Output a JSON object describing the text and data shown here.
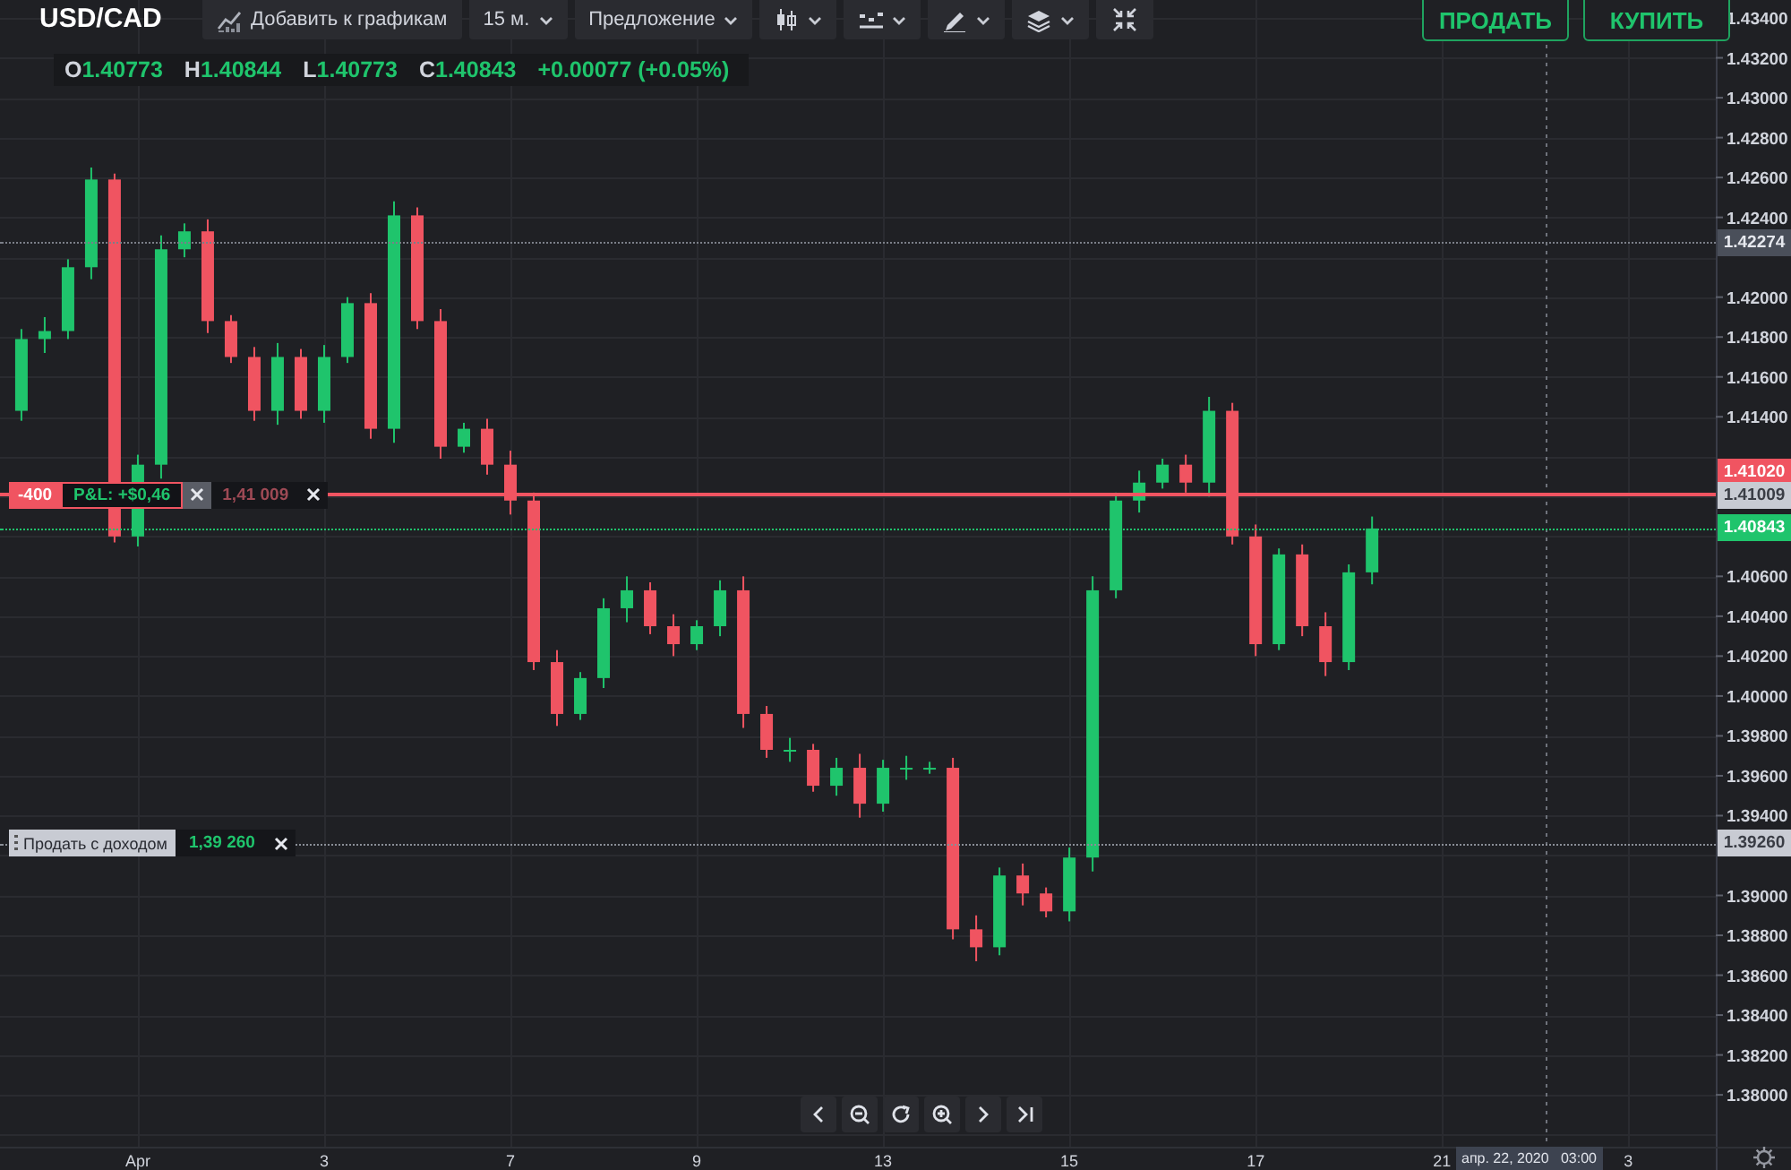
{
  "symbol": "USD/CAD",
  "toolbar": [
    {
      "kind": "add",
      "label": "Добавить к графикам"
    },
    {
      "kind": "dropdown",
      "label": "15 м."
    },
    {
      "kind": "dropdown",
      "label": "Предложение"
    },
    {
      "kind": "icon-dropdown"
    },
    {
      "kind": "icon-dropdown"
    },
    {
      "kind": "icon-dropdown"
    },
    {
      "kind": "icon-dropdown"
    },
    {
      "kind": "icon"
    }
  ],
  "ohlc": [
    {
      "key": "O",
      "value": "1.40773"
    },
    {
      "key": "H",
      "value": "1.40844"
    },
    {
      "key": "L",
      "value": "1.40773"
    },
    {
      "key": "C",
      "value": "1.40843"
    }
  ],
  "change": "+0.00077 (+0.05%)",
  "actions": [
    {
      "label": "ПРОДАТЬ"
    },
    {
      "label": "КУПИТЬ"
    }
  ],
  "orders": [
    {
      "kind": "position",
      "quantity": "-400",
      "pnl": "P&L: +$0,46",
      "price": "1,41 009"
    },
    {
      "kind": "take-profit",
      "label": "Продать с доходом",
      "price": "1,39 260"
    }
  ],
  "price_labels": [
    {
      "kind": "marker",
      "value": "1.42274",
      "color": "#4a4f5a"
    },
    {
      "kind": "ask",
      "value": "1.41020",
      "color": "#f05461"
    },
    {
      "kind": "order",
      "value": "1.41009",
      "color": "#c8cbd3"
    },
    {
      "kind": "last",
      "value": "1.40843",
      "color": "#1fc46c"
    },
    {
      "kind": "order",
      "value": "1.39260",
      "color": "#c8cbd3"
    }
  ],
  "crosshair": {
    "label": "апр. 22, 2020   03:00"
  },
  "nav": [
    {
      "kind": "prev"
    },
    {
      "kind": "zoom-out"
    },
    {
      "kind": "reset"
    },
    {
      "kind": "zoom-in"
    },
    {
      "kind": "next"
    },
    {
      "kind": "end"
    }
  ],
  "chart_data": {
    "type": "candlestick",
    "grid": true,
    "categories": [
      null,
      null,
      null,
      null,
      null,
      "Apr",
      null,
      null,
      null,
      null,
      null,
      null,
      null,
      "3",
      null,
      null,
      null,
      null,
      null,
      null,
      null,
      "7",
      null,
      null,
      null,
      null,
      null,
      null,
      null,
      "9",
      null,
      null,
      null,
      null,
      null,
      null,
      null,
      "13",
      null,
      null,
      null,
      null,
      null,
      null,
      null,
      "15",
      null,
      null,
      null,
      null,
      null,
      null,
      null,
      "17",
      null,
      null,
      null,
      null,
      null,
      null,
      null,
      "21",
      null,
      null,
      null,
      null,
      null,
      null,
      null,
      "3"
    ],
    "ohlc": [
      [
        1.4143,
        1.4184,
        1.4138,
        1.4179
      ],
      [
        1.4179,
        1.419,
        1.4172,
        1.4183
      ],
      [
        1.4183,
        1.4219,
        1.4179,
        1.4215
      ],
      [
        1.4215,
        1.4265,
        1.4209,
        1.4259
      ],
      [
        1.4259,
        1.4262,
        1.4077,
        1.408
      ],
      [
        1.408,
        1.4121,
        1.4075,
        1.4116
      ],
      [
        1.4116,
        1.4231,
        1.4109,
        1.4224
      ],
      [
        1.4224,
        1.4237,
        1.422,
        1.4233
      ],
      [
        1.4233,
        1.4239,
        1.4182,
        1.4188
      ],
      [
        1.4188,
        1.4191,
        1.4167,
        1.417
      ],
      [
        1.417,
        1.4175,
        1.4138,
        1.4143
      ],
      [
        1.4143,
        1.4177,
        1.4136,
        1.417
      ],
      [
        1.417,
        1.4174,
        1.4139,
        1.4143
      ],
      [
        1.4143,
        1.4176,
        1.4137,
        1.417
      ],
      [
        1.417,
        1.42,
        1.4167,
        1.4197
      ],
      [
        1.4197,
        1.4202,
        1.4129,
        1.4134
      ],
      [
        1.4134,
        1.4248,
        1.4127,
        1.4241
      ],
      [
        1.4241,
        1.4245,
        1.4184,
        1.4188
      ],
      [
        1.4188,
        1.4194,
        1.4119,
        1.4125
      ],
      [
        1.4125,
        1.4137,
        1.4122,
        1.4134
      ],
      [
        1.4134,
        1.4139,
        1.4111,
        1.4116
      ],
      [
        1.4116,
        1.4123,
        1.4091,
        1.4098
      ],
      [
        1.4098,
        1.4102,
        1.4013,
        1.4017
      ],
      [
        1.4017,
        1.4023,
        1.3985,
        1.3991
      ],
      [
        1.3991,
        1.4012,
        1.3988,
        1.4009
      ],
      [
        1.4009,
        1.4049,
        1.4004,
        1.4044
      ],
      [
        1.4044,
        1.406,
        1.4037,
        1.4053
      ],
      [
        1.4053,
        1.4057,
        1.4031,
        1.4035
      ],
      [
        1.4035,
        1.4041,
        1.402,
        1.4026
      ],
      [
        1.4026,
        1.4038,
        1.4023,
        1.4035
      ],
      [
        1.4035,
        1.4058,
        1.403,
        1.4053
      ],
      [
        1.4053,
        1.406,
        1.3984,
        1.3991
      ],
      [
        1.3991,
        1.3995,
        1.3969,
        1.3973
      ],
      [
        1.3973,
        1.3979,
        1.3967,
        1.3973
      ],
      [
        1.3973,
        1.3976,
        1.3952,
        1.3955
      ],
      [
        1.3955,
        1.3969,
        1.395,
        1.3964
      ],
      [
        1.3964,
        1.3971,
        1.3939,
        1.3946
      ],
      [
        1.3946,
        1.3968,
        1.3942,
        1.3964
      ],
      [
        1.3964,
        1.397,
        1.3958,
        1.3964
      ],
      [
        1.3964,
        1.3967,
        1.3961,
        1.3964
      ],
      [
        1.3964,
        1.3969,
        1.3878,
        1.3883
      ],
      [
        1.3883,
        1.389,
        1.3867,
        1.3874
      ],
      [
        1.3874,
        1.3914,
        1.387,
        1.391
      ],
      [
        1.391,
        1.3916,
        1.3895,
        1.3901
      ],
      [
        1.3901,
        1.3904,
        1.3889,
        1.3892
      ],
      [
        1.3892,
        1.3924,
        1.3887,
        1.3919
      ],
      [
        1.3919,
        1.406,
        1.3912,
        1.4053
      ],
      [
        1.4053,
        1.4102,
        1.4049,
        1.4098
      ],
      [
        1.4098,
        1.4113,
        1.4092,
        1.4107
      ],
      [
        1.4107,
        1.4119,
        1.4104,
        1.4116
      ],
      [
        1.4116,
        1.4121,
        1.4102,
        1.4107
      ],
      [
        1.4107,
        1.415,
        1.41,
        1.4143
      ],
      [
        1.4143,
        1.4147,
        1.4076,
        1.408
      ],
      [
        1.408,
        1.4086,
        1.402,
        1.4026
      ],
      [
        1.4026,
        1.4074,
        1.4023,
        1.4071
      ],
      [
        1.4071,
        1.4076,
        1.403,
        1.4035
      ],
      [
        1.4035,
        1.4042,
        1.401,
        1.4017
      ],
      [
        1.4017,
        1.4066,
        1.4013,
        1.4062
      ],
      [
        1.4062,
        1.409,
        1.4056,
        1.4084
      ],
      null,
      null,
      null,
      null,
      null,
      null,
      null,
      null,
      null,
      null,
      null
    ],
    "ylim": [
      1.3774,
      1.4349
    ],
    "yticks": [
      {
        "value": 1.434,
        "label": "1.43400"
      },
      {
        "value": 1.432,
        "label": "1.43200"
      },
      {
        "value": 1.43,
        "label": "1.43000"
      },
      {
        "value": 1.428,
        "label": "1.42800"
      },
      {
        "value": 1.426,
        "label": "1.42600"
      },
      {
        "value": 1.424,
        "label": "1.42400"
      },
      {
        "value": 1.42,
        "label": "1.42000"
      },
      {
        "value": 1.418,
        "label": "1.41800"
      },
      {
        "value": 1.416,
        "label": "1.41600"
      },
      {
        "value": 1.414,
        "label": "1.41400"
      },
      {
        "value": 1.406,
        "label": "1.40600"
      },
      {
        "value": 1.404,
        "label": "1.40400"
      },
      {
        "value": 1.402,
        "label": "1.40200"
      },
      {
        "value": 1.4,
        "label": "1.40000"
      },
      {
        "value": 1.398,
        "label": "1.39800"
      },
      {
        "value": 1.396,
        "label": "1.39600"
      },
      {
        "value": 1.394,
        "label": "1.39400"
      },
      {
        "value": 1.39,
        "label": "1.39000"
      },
      {
        "value": 1.388,
        "label": "1.38800"
      },
      {
        "value": 1.386,
        "label": "1.38600"
      },
      {
        "value": 1.384,
        "label": "1.38400"
      },
      {
        "value": 1.382,
        "label": "1.38200"
      },
      {
        "value": 1.38,
        "label": "1.38000"
      }
    ]
  }
}
